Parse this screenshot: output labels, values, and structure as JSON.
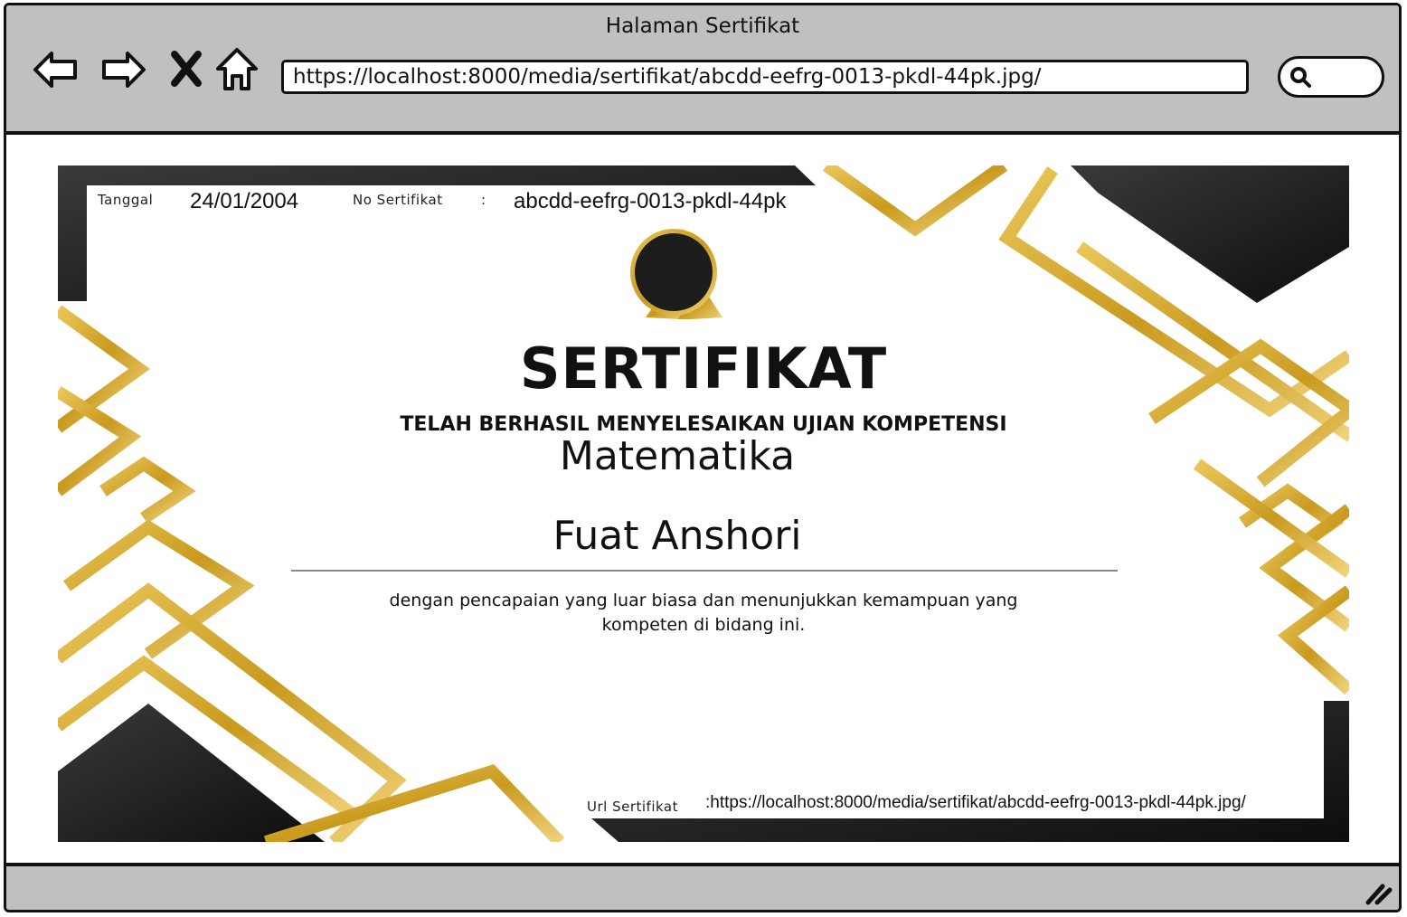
{
  "window": {
    "title": "Halaman Sertifikat"
  },
  "toolbar": {
    "back_icon": "back-arrow-icon",
    "forward_icon": "forward-arrow-icon",
    "close_icon": "close-icon",
    "home_icon": "home-icon",
    "url": "https://localhost:8000/media/sertifikat/abcdd-eefrg-0013-pkdl-44pk.jpg/",
    "search_icon": "search-icon"
  },
  "certificate": {
    "date_label": "Tanggal",
    "date_value": "24/01/2004",
    "number_label": "No Sertifikat",
    "number_sep": ":",
    "number_value": "abcdd-eefrg-0013-pkdl-44pk",
    "title": "SERTIFIKAT",
    "subtitle": "TELAH BERHASIL MENYELESAIKAN UJIAN KOMPETENSI",
    "course": "Matematika",
    "recipient": "Fuat Anshori",
    "description_line1": "dengan pencapaian yang luar biasa dan menunjukkan kemampuan yang",
    "description_line2": "kompeten di bidang ini.",
    "url_label": "Url Sertifikat",
    "url_value": ":https://localhost:8000/media/sertifikat/abcdd-eefrg-0013-pkdl-44pk.jpg/"
  },
  "colors": {
    "gold": "#D4A52A",
    "dark": "#1E1E1E",
    "chrome": "#C0C0C0"
  }
}
